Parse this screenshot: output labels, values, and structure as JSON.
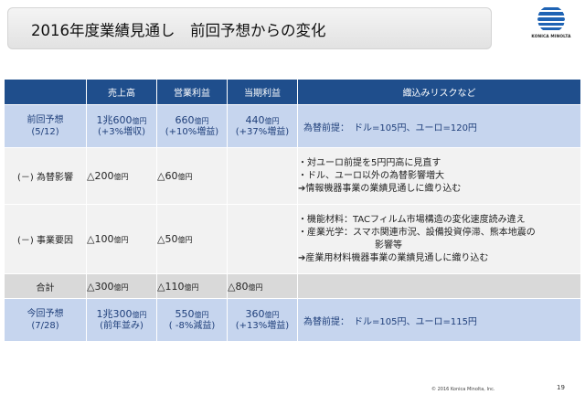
{
  "title": "2016年度業績見通し　前回予想からの変化",
  "logo": {
    "text": "KONICA MINOLTA",
    "color": "#1e63b4"
  },
  "table": {
    "headers": [
      "",
      "売上高",
      "営業利益",
      "当期利益",
      "織込みリスクなど"
    ],
    "previous": {
      "label": "前回予想",
      "date": "(5/12)",
      "sales": {
        "value": "1兆600",
        "unit": "億円",
        "sub": "(+3%増収)"
      },
      "op_profit": {
        "value": "660",
        "unit": "億円",
        "sub": "(+10%増益)"
      },
      "net_profit": {
        "value": "440",
        "unit": "億円",
        "sub": "(+37%増益)"
      },
      "risk": "為替前提：　ドル=105円、ユーロ=120円"
    },
    "fx": {
      "label": "(－) 為替影響",
      "sales": {
        "value": "△200",
        "unit": "億円"
      },
      "op_profit": {
        "value": "△60",
        "unit": "億円"
      },
      "notes": [
        "・対ユーロ前提を5円円高に見直す",
        "・ドル、ユーロ以外の為替影響増大",
        "➔情報機器事業の業績見通しに織り込む"
      ]
    },
    "business": {
      "label": "(－) 事業要因",
      "sales": {
        "value": "△100",
        "unit": "億円"
      },
      "op_profit": {
        "value": "△50",
        "unit": "億円"
      },
      "notes": [
        "・機能材料：TACフィルム市場構造の変化速度読み違え",
        "・産業光学：スマホ関連市況、設備投資停滞、熊本地震の",
        "影響等",
        "➔産業用材料機器事業の業績見通しに織り込む"
      ]
    },
    "total": {
      "label": "合計",
      "sales": {
        "value": "△300",
        "unit": "億円"
      },
      "op_profit": {
        "value": "△110",
        "unit": "億円"
      },
      "net_profit": {
        "value": "△80",
        "unit": "億円"
      }
    },
    "current": {
      "label": "今回予想",
      "date": "(7/28)",
      "sales": {
        "value": "1兆300",
        "unit": "億円",
        "sub": "(前年並み)"
      },
      "op_profit": {
        "value": "550",
        "unit": "億円",
        "sub": "( -8%減益)"
      },
      "net_profit": {
        "value": "360",
        "unit": "億円",
        "sub": "(+13%増益)"
      },
      "risk": "為替前提：　ドル=105円、ユーロ=115円"
    }
  },
  "footer": {
    "copyright": "© 2016 Konica Minolta, Inc.",
    "page": "19"
  },
  "colors": {
    "header": "#1f4e8c",
    "highlight_row": "#c6d5ee",
    "white_row": "#f2f2f2",
    "total_row": "#d9d9d9"
  }
}
